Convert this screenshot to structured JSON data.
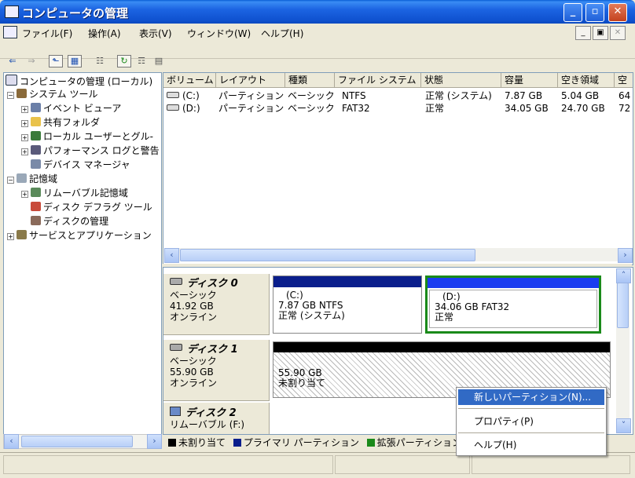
{
  "window": {
    "title": "コンピュータの管理"
  },
  "menubar": {
    "items": [
      "ファイル(F)",
      "操作(A)",
      "表示(V)",
      "ウィンドウ(W)",
      "ヘルプ(H)"
    ]
  },
  "toolbar": {
    "icons": [
      "back-arrow-icon",
      "forward-arrow-icon",
      "up-folder-icon",
      "show-tree-icon",
      "properties-icon",
      "refresh-icon",
      "export-icon",
      "help-icon"
    ]
  },
  "tree": {
    "root": "コンピュータの管理 (ローカル)",
    "system_tools": "システム ツール",
    "event_viewer": "イベント ビューア",
    "shared_folders": "共有フォルダ",
    "local_users": "ローカル ユーザーとグル-",
    "performance": "パフォーマンス ログと警告",
    "device_manager": "デバイス マネージャ",
    "storage": "記憶域",
    "removable_storage": "リムーバブル記憶域",
    "defrag": "ディスク デフラグ ツール",
    "disk_management": "ディスクの管理",
    "services_apps": "サービスとアプリケーション"
  },
  "volume_list": {
    "columns": [
      "ボリューム",
      "レイアウト",
      "種類",
      "ファイル システム",
      "状態",
      "容量",
      "空き領域",
      "空"
    ],
    "rows": [
      {
        "volume": "(C:)",
        "layout": "パーティション",
        "type": "ベーシック",
        "fs": "NTFS",
        "status": "正常 (システム)",
        "capacity": "7.87 GB",
        "free": "5.04 GB",
        "pct": "64"
      },
      {
        "volume": "(D:)",
        "layout": "パーティション",
        "type": "ベーシック",
        "fs": "FAT32",
        "status": "正常",
        "capacity": "34.05 GB",
        "free": "24.70 GB",
        "pct": "72"
      }
    ]
  },
  "disks": [
    {
      "name": "ディスク 0",
      "type": "ベーシック",
      "size": "41.92 GB",
      "state": "オンライン",
      "partitions": [
        {
          "label": "(C:)",
          "detail": "7.87 GB NTFS",
          "status": "正常 (システム)"
        },
        {
          "label": "(D:)",
          "detail": "34.06 GB FAT32",
          "status": "正常"
        }
      ]
    },
    {
      "name": "ディスク 1",
      "type": "ベーシック",
      "size": "55.90 GB",
      "state": "オンライン",
      "partitions": [
        {
          "label": "",
          "detail": "55.90 GB",
          "status": "未割り当て"
        }
      ]
    },
    {
      "name": "ディスク 2",
      "type": "リムーバブル (F:)"
    }
  ],
  "legend": [
    {
      "label": "未割り当て",
      "color": "#000000"
    },
    {
      "label": "プライマリ パーティション",
      "color": "#0a1e8c"
    },
    {
      "label": "拡張パーティション",
      "color": "#1a8a1a"
    }
  ],
  "context_menu": {
    "items": [
      "新しいパーティション(N)...",
      "プロパティ(P)",
      "ヘルプ(H)"
    ]
  },
  "colors": {
    "titlebar": "#0a5fd6",
    "primary_partition": "#0a1e8c",
    "selected_partition_bar": "#1a3cf0",
    "selection_border": "#1a8a1a",
    "menu_highlight": "#316ac5"
  }
}
